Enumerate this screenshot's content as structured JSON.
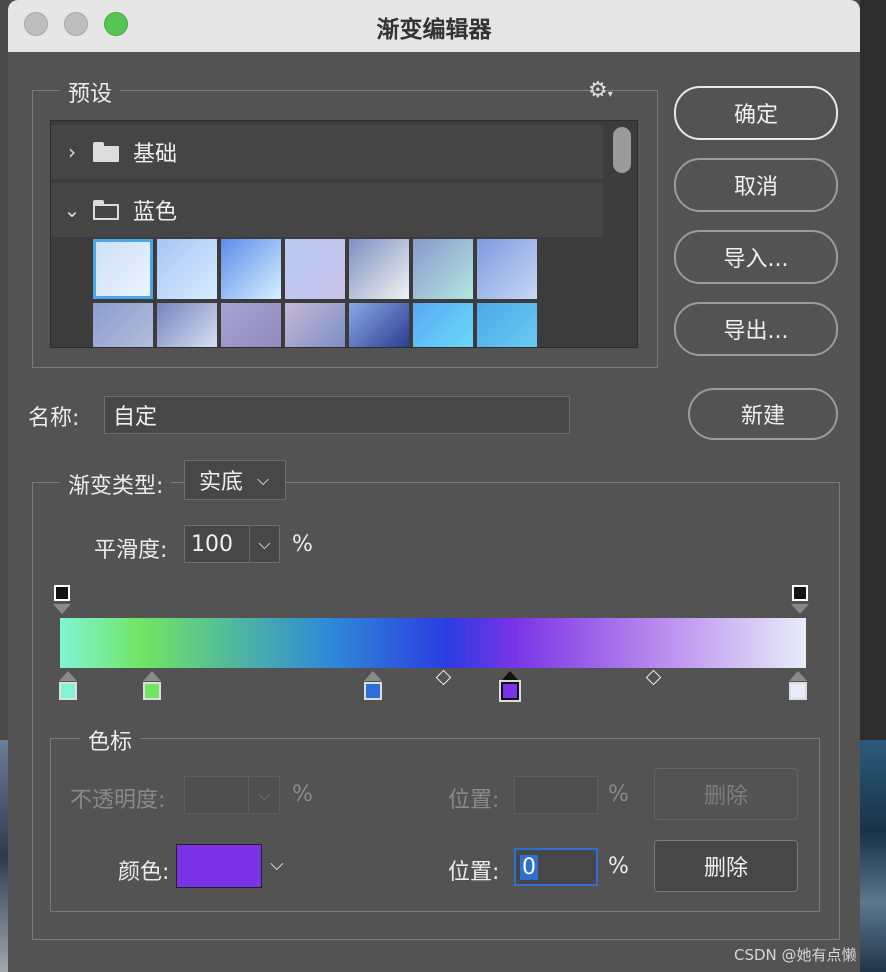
{
  "window": {
    "title": "渐变编辑器"
  },
  "presets": {
    "label": "预设",
    "folders": [
      {
        "name": "基础",
        "state": "collapsed"
      },
      {
        "name": "蓝色",
        "state": "expanded"
      }
    ],
    "swatches": [
      {
        "from": "#cfe0f8",
        "to": "#ecf3ff",
        "selected": true
      },
      {
        "from": "#a9c6f3",
        "to": "#d7ecff"
      },
      {
        "from": "#5b8cea",
        "to": "#d8f0ff"
      },
      {
        "from": "#b8ccf4",
        "to": "#c9c2ea"
      },
      {
        "from": "#7e8fc4",
        "to": "#f0f4f2"
      },
      {
        "from": "#8a98cc",
        "to": "#b0e8e0"
      },
      {
        "from": "#7f9ae0",
        "to": "#c5d8f4"
      },
      {
        "from": "#8d9ccd",
        "to": "#b8c4e0"
      },
      {
        "from": "#7584bf",
        "to": "#e6eef8"
      },
      {
        "from": "#a6a4d2",
        "to": "#8e86ba"
      },
      {
        "from": "#c8b8d8",
        "to": "#6e88c0"
      },
      {
        "from": "#8aa8e4",
        "to": "#1c2e86"
      },
      {
        "from": "#5ca8f4",
        "to": "#6ae2fa"
      },
      {
        "from": "#4ea8e8",
        "to": "#6ed0f2"
      }
    ]
  },
  "buttons": {
    "ok": "确定",
    "cancel": "取消",
    "import": "导入...",
    "export": "导出...",
    "new": "新建"
  },
  "name": {
    "label": "名称:",
    "value": "自定"
  },
  "gradient": {
    "type_label": "渐变类型:",
    "type_value": "实底",
    "smooth_label": "平滑度:",
    "smooth_value": "100",
    "percent": "%",
    "stops": [
      {
        "color": "#80f4d4",
        "pos": 0
      },
      {
        "color": "#72e464",
        "pos": 11.5
      },
      {
        "color": "#2f6ed8",
        "pos": 41.8
      },
      {
        "color": "#7a34e6",
        "pos": 60.5,
        "active": true
      },
      {
        "color": "#e8ecfa",
        "pos": 100
      }
    ],
    "midpoints": [
      51.4,
      80.2
    ]
  },
  "color_stops": {
    "label": "色标",
    "opacity_label": "不透明度:",
    "opacity_value": "",
    "percent": "%",
    "location_label": "位置:",
    "location_value_disabled": "",
    "delete": "删除",
    "color_label": "颜色:",
    "color_value": "#7a34e6",
    "location_value": "0"
  },
  "watermark": "CSDN @她有点懒"
}
